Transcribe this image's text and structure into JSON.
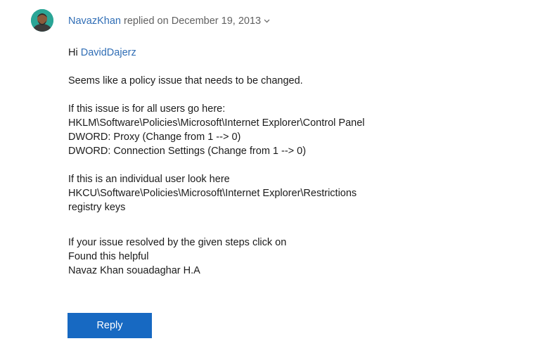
{
  "reply": {
    "author": "NavazKhan",
    "action": " replied on ",
    "date": "December 19, 2013",
    "greeting_prefix": "Hi ",
    "mention": "DavidDajerz",
    "paragraphs": [
      [
        "Seems like a policy issue that needs to be changed."
      ],
      [
        "If this issue is for all users go here:",
        "HKLM\\Software\\Policies\\Microsoft\\Internet Explorer\\Control Panel",
        "DWORD: Proxy (Change from 1 --> 0)",
        "DWORD: Connection Settings (Change from 1 --> 0)"
      ],
      [
        "If this is an individual user look here",
        "HKCU\\Software\\Policies\\Microsoft\\Internet Explorer\\Restrictions",
        "registry keys"
      ],
      [
        "If your issue resolved by the given steps click on",
        "Found this helpful",
        "Navaz Khan souadaghar H.A"
      ]
    ],
    "icons": {
      "avatar": "user-avatar",
      "chevron": "chevron-down-icon"
    }
  },
  "actions": {
    "reply_label": "Reply"
  },
  "colors": {
    "link": "#2f6db5",
    "button": "#1769c2",
    "text": "#1b1b1b",
    "meta": "#616161"
  }
}
